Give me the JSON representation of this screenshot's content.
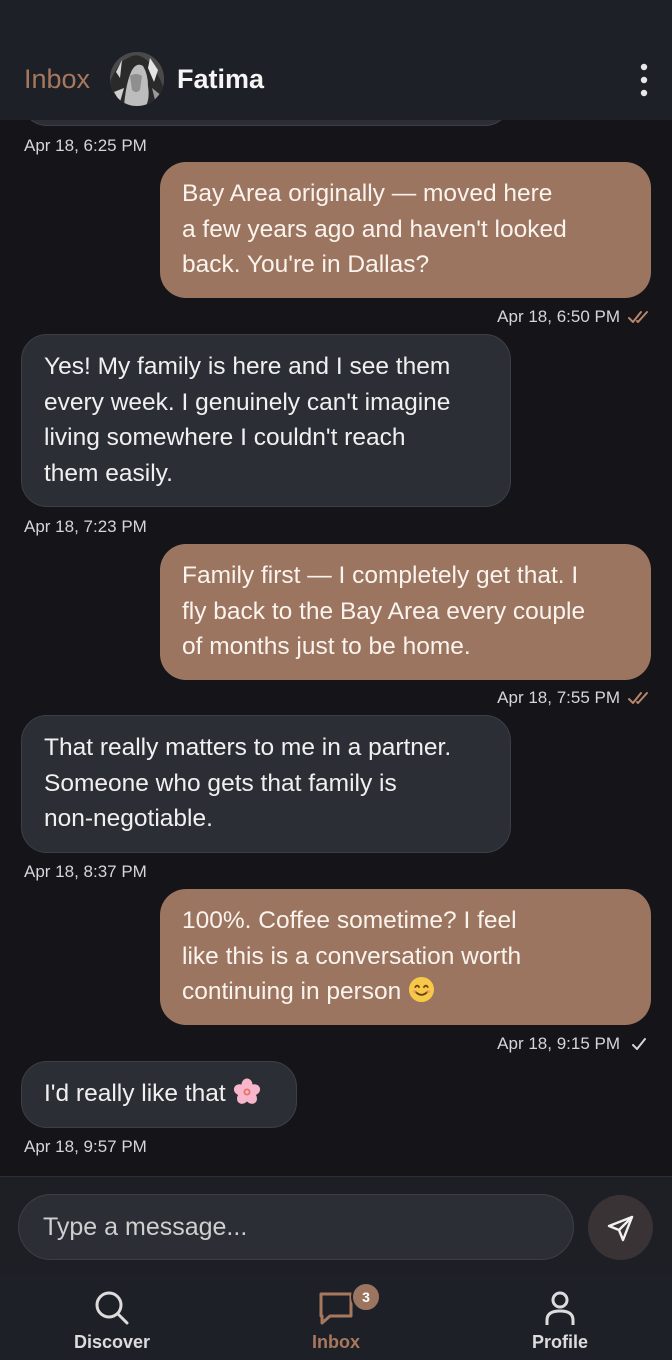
{
  "header": {
    "back_label": "Inbox",
    "contact_name": "Fatima"
  },
  "messages": [
    {
      "dir": "in",
      "text": "",
      "time": "Apr 18, 6:25 PM"
    },
    {
      "dir": "out",
      "text": "Bay Area originally — moved here\na few years ago and haven't looked\nback. You're in Dallas?",
      "time": "Apr 18, 6:50 PM",
      "status": "read"
    },
    {
      "dir": "in",
      "text": "Yes! My family is here and I see them\nevery week. I genuinely can't imagine\nliving somewhere I couldn't reach\nthem easily.",
      "time": "Apr 18, 7:23 PM"
    },
    {
      "dir": "out",
      "text": "Family first — I completely get that. I\nfly back to the Bay Area every couple\nof months just to be home.",
      "time": "Apr 18, 7:55 PM",
      "status": "read"
    },
    {
      "dir": "in",
      "text": "That really matters to me in a partner.\nSomeone who gets that family is\nnon-negotiable.",
      "time": "Apr 18, 8:37 PM"
    },
    {
      "dir": "out",
      "text": "100%. Coffee sometime? I feel\nlike this is a conversation worth\ncontinuing in person",
      "emoji": "smiling-face-icon",
      "time": "Apr 18, 9:15 PM",
      "status": "sent"
    },
    {
      "dir": "in",
      "text": "I'd really like that",
      "emoji": "cherry-blossom-icon",
      "time": "Apr 18, 9:57 PM"
    }
  ],
  "composer": {
    "placeholder": "Type a message..."
  },
  "nav": {
    "items": [
      {
        "label": "Discover",
        "icon": "search-icon"
      },
      {
        "label": "Inbox",
        "icon": "chat-icon",
        "badge": "3",
        "active": true
      },
      {
        "label": "Profile",
        "icon": "person-icon"
      }
    ]
  },
  "colors": {
    "accent": "#a8785e",
    "outgoing_bubble": "#9b7560",
    "incoming_bubble": "#2c2e35",
    "background": "#141419"
  }
}
